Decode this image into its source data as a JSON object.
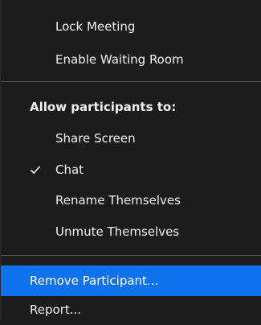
{
  "menu": {
    "lock_meeting": "Lock Meeting",
    "enable_waiting_room": "Enable Waiting Room",
    "allow_heading": "Allow participants to:",
    "share_screen": "Share Screen",
    "chat": "Chat",
    "chat_checked": true,
    "rename_themselves": "Rename Themselves",
    "unmute_themselves": "Unmute Themselves",
    "remove_participant": "Remove Participant...",
    "report": "Report..."
  },
  "colors": {
    "background": "#1c1c1c",
    "highlight": "#0e72ed",
    "separator": "#5a5a5a",
    "text": "#f2f2f2"
  }
}
